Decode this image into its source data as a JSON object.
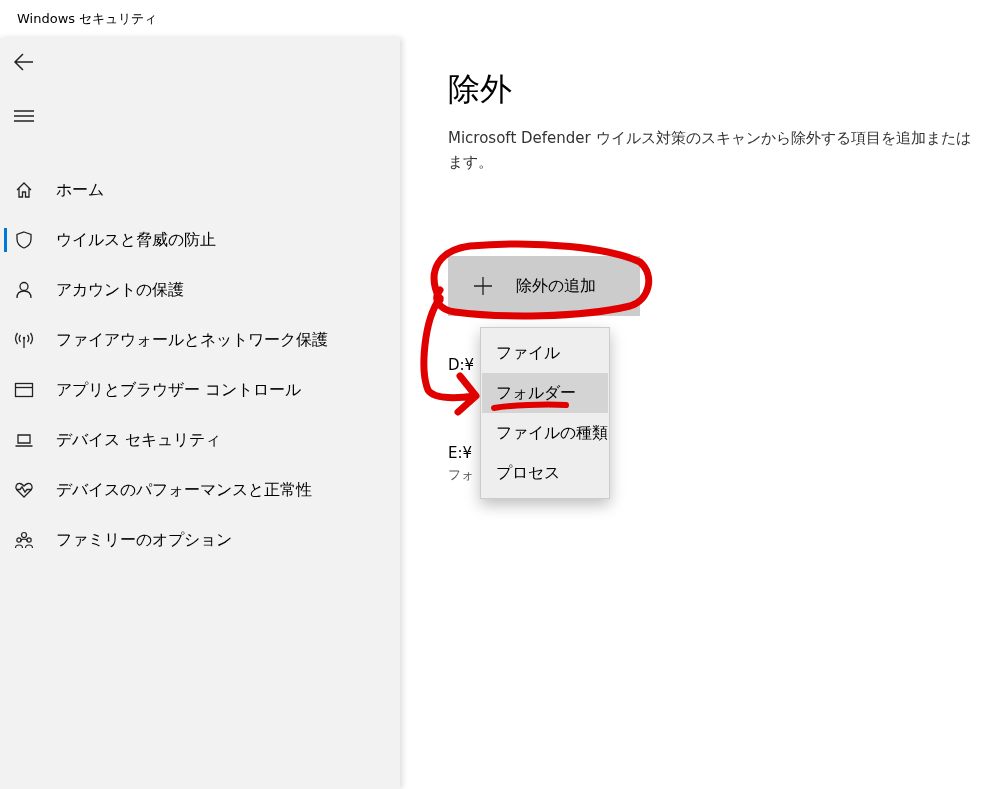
{
  "window": {
    "title": "Windows セキュリティ"
  },
  "sidebar": {
    "items": [
      {
        "kind": "home",
        "label": "ホーム",
        "selected": false
      },
      {
        "kind": "shield",
        "label": "ウイルスと脅威の防止",
        "selected": true
      },
      {
        "kind": "person",
        "label": "アカウントの保護",
        "selected": false
      },
      {
        "kind": "antenna",
        "label": "ファイアウォールとネットワーク保護",
        "selected": false
      },
      {
        "kind": "window",
        "label": "アプリとブラウザー コントロール",
        "selected": false
      },
      {
        "kind": "laptop",
        "label": "デバイス セキュリティ",
        "selected": false
      },
      {
        "kind": "heart",
        "label": "デバイスのパフォーマンスと正常性",
        "selected": false
      },
      {
        "kind": "family",
        "label": "ファミリーのオプション",
        "selected": false
      }
    ]
  },
  "page": {
    "title": "除外",
    "description": [
      "Microsoft Defender ウイルス対策のスキャンから除外する項目を追加または",
      "ます。"
    ],
    "add_button": {
      "label": "除外の追加"
    },
    "menu": [
      {
        "label": "ファイル",
        "selected": false
      },
      {
        "label": "フォルダー",
        "selected": true
      },
      {
        "label": "ファイルの種類",
        "selected": false
      },
      {
        "label": "プロセス",
        "selected": false
      }
    ],
    "exclusions": [
      {
        "path": "D:¥"
      },
      {
        "path": "E:¥",
        "type": "フォ"
      }
    ]
  }
}
